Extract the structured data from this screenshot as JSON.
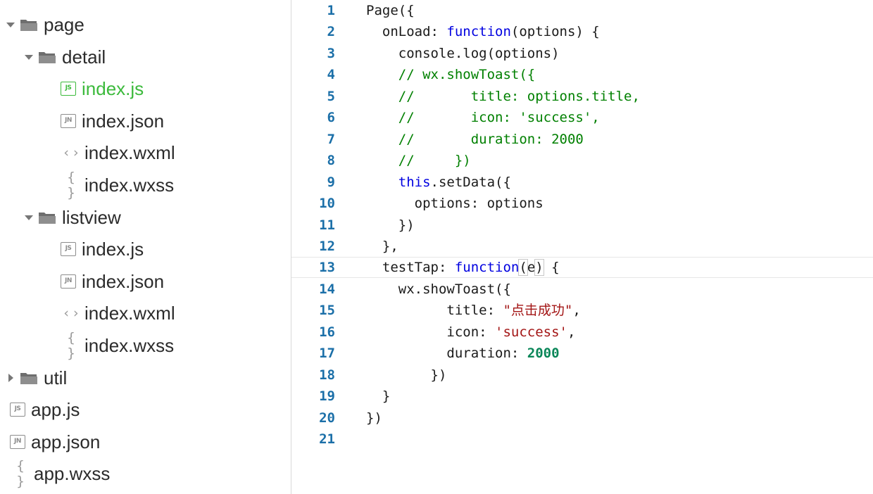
{
  "file_tree": [
    {
      "name": "page-folder",
      "label": "page",
      "type": "folder",
      "expanded": true,
      "level": 0
    },
    {
      "name": "detail-folder",
      "label": "detail",
      "type": "folder",
      "expanded": true,
      "level": 1
    },
    {
      "name": "detail-index-js",
      "label": "index.js",
      "type": "js",
      "icon_text": "JS",
      "active": true,
      "level": 2
    },
    {
      "name": "detail-index-json",
      "label": "index.json",
      "type": "json",
      "icon_text": "JN",
      "level": 2
    },
    {
      "name": "detail-index-wxml",
      "label": "index.wxml",
      "type": "wxml",
      "icon_text": "‹ ›",
      "level": 2
    },
    {
      "name": "detail-index-wxss",
      "label": "index.wxss",
      "type": "wxss",
      "icon_text": "{ }",
      "level": 2
    },
    {
      "name": "listview-folder",
      "label": "listview",
      "type": "folder",
      "expanded": true,
      "level": 1
    },
    {
      "name": "listview-index-js",
      "label": "index.js",
      "type": "js",
      "icon_text": "JS",
      "level": 2
    },
    {
      "name": "listview-index-json",
      "label": "index.json",
      "type": "json",
      "icon_text": "JN",
      "level": 2
    },
    {
      "name": "listview-index-wxml",
      "label": "index.wxml",
      "type": "wxml",
      "icon_text": "‹ ›",
      "level": 2
    },
    {
      "name": "listview-index-wxss",
      "label": "index.wxss",
      "type": "wxss",
      "icon_text": "{ }",
      "level": 2
    },
    {
      "name": "util-folder",
      "label": "util",
      "type": "folder",
      "expanded": false,
      "level": 0
    },
    {
      "name": "app-js",
      "label": "app.js",
      "type": "js",
      "icon_text": "JS",
      "level": 0
    },
    {
      "name": "app-json",
      "label": "app.json",
      "type": "json",
      "icon_text": "JN",
      "level": 0
    },
    {
      "name": "app-wxss",
      "label": "app.wxss",
      "type": "wxss",
      "icon_text": "{ }",
      "level": 0
    }
  ],
  "editor": {
    "current_line": 13,
    "lines": [
      {
        "n": "1",
        "tokens": [
          [
            "p",
            "Page({"
          ]
        ]
      },
      {
        "n": "2",
        "tokens": [
          [
            "p",
            "  onLoad: "
          ],
          [
            "k",
            "function"
          ],
          [
            "p",
            "(options) {"
          ]
        ]
      },
      {
        "n": "3",
        "tokens": [
          [
            "p",
            "    console.log(options)"
          ]
        ]
      },
      {
        "n": "4",
        "tokens": [
          [
            "c",
            "    // wx.showToast({"
          ]
        ]
      },
      {
        "n": "5",
        "tokens": [
          [
            "c",
            "    //       title: options.title,"
          ]
        ]
      },
      {
        "n": "6",
        "tokens": [
          [
            "c",
            "    //       icon: 'success',"
          ]
        ]
      },
      {
        "n": "7",
        "tokens": [
          [
            "c",
            "    //       duration: 2000"
          ]
        ]
      },
      {
        "n": "8",
        "tokens": [
          [
            "c",
            "    //     })"
          ]
        ]
      },
      {
        "n": "9",
        "tokens": [
          [
            "p",
            "    "
          ],
          [
            "k",
            "this"
          ],
          [
            "p",
            ".setData({"
          ]
        ]
      },
      {
        "n": "10",
        "tokens": [
          [
            "p",
            "      options: options"
          ]
        ]
      },
      {
        "n": "11",
        "tokens": [
          [
            "p",
            "    })"
          ]
        ]
      },
      {
        "n": "12",
        "tokens": [
          [
            "p",
            "  },"
          ]
        ]
      },
      {
        "n": "13",
        "tokens": [
          [
            "p",
            "  testTap: "
          ],
          [
            "k",
            "function"
          ],
          [
            "b",
            "("
          ],
          [
            "p",
            "e"
          ],
          [
            "b",
            ")"
          ],
          [
            "p",
            " {"
          ]
        ]
      },
      {
        "n": "14",
        "tokens": [
          [
            "p",
            "    wx.showToast({"
          ]
        ]
      },
      {
        "n": "15",
        "tokens": [
          [
            "p",
            "          title: "
          ],
          [
            "s",
            "\"点击成功\""
          ],
          [
            "p",
            ","
          ]
        ]
      },
      {
        "n": "16",
        "tokens": [
          [
            "p",
            "          icon: "
          ],
          [
            "s",
            "'success'"
          ],
          [
            "p",
            ","
          ]
        ]
      },
      {
        "n": "17",
        "tokens": [
          [
            "p",
            "          duration: "
          ],
          [
            "n",
            "2000"
          ]
        ]
      },
      {
        "n": "18",
        "tokens": [
          [
            "p",
            "        })"
          ]
        ]
      },
      {
        "n": "19",
        "tokens": [
          [
            "p",
            "  }"
          ]
        ]
      },
      {
        "n": "20",
        "tokens": [
          [
            "p",
            "})"
          ]
        ]
      },
      {
        "n": "21",
        "tokens": [
          [
            "p",
            ""
          ]
        ]
      }
    ]
  },
  "colors": {
    "active_file": "#3cba3c",
    "line_number": "#1b6fa8",
    "keyword": "#0000e0",
    "string": "#a31515",
    "number": "#098658",
    "comment": "#008000"
  }
}
